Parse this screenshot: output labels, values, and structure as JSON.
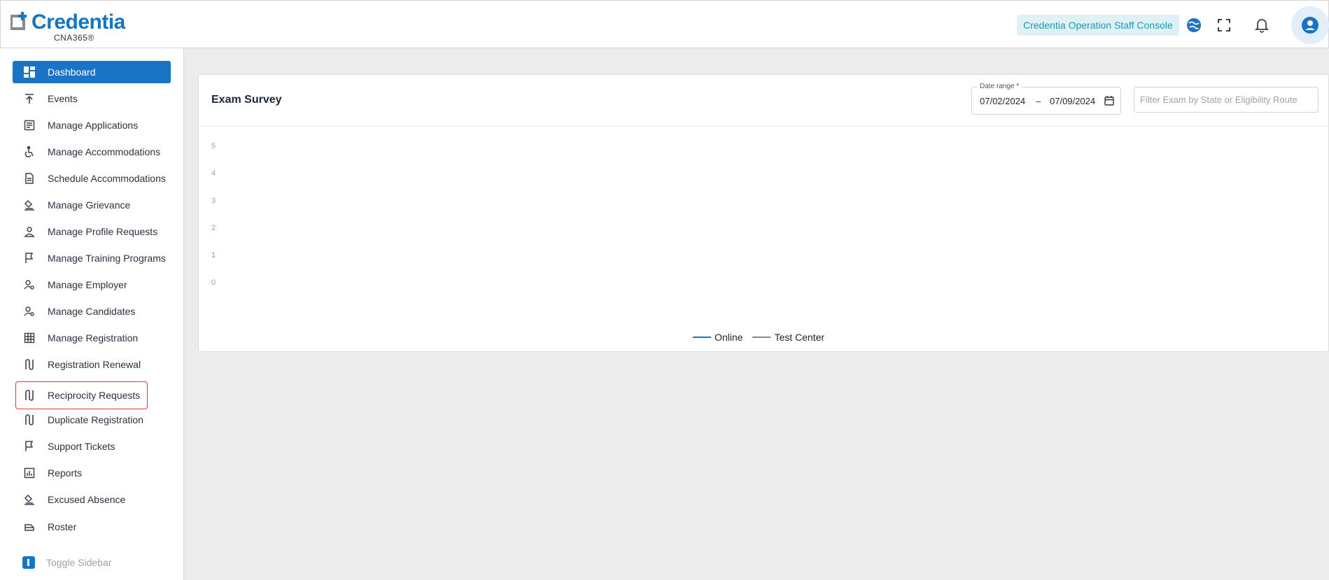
{
  "header": {
    "logo_text": "Credentia",
    "logo_sub": "CNA365®",
    "console_label": "Credentia Operation Staff Console"
  },
  "sidebar": {
    "items": [
      {
        "label": "Dashboard",
        "icon": "dashboard-icon",
        "active": true
      },
      {
        "label": "Events",
        "icon": "upload-icon"
      },
      {
        "label": "Manage Applications",
        "icon": "list-icon"
      },
      {
        "label": "Manage Accommodations",
        "icon": "accessibility-icon"
      },
      {
        "label": "Schedule Accommodations",
        "icon": "document-icon"
      },
      {
        "label": "Manage Grievance",
        "icon": "gavel-icon"
      },
      {
        "label": "Manage Profile Requests",
        "icon": "person-icon"
      },
      {
        "label": "Manage Training Programs",
        "icon": "flag-icon"
      },
      {
        "label": "Manage Employer",
        "icon": "user-gear-icon"
      },
      {
        "label": "Manage Candidates",
        "icon": "user-gear-icon"
      },
      {
        "label": "Manage Registration",
        "icon": "grid-icon"
      },
      {
        "label": "Registration Renewal",
        "icon": "route-icon"
      },
      {
        "label": "Reciprocity Requests",
        "icon": "route-icon",
        "highlight": true
      },
      {
        "label": "Duplicate Registration",
        "icon": "route-icon"
      },
      {
        "label": "Support Tickets",
        "icon": "flag-icon"
      },
      {
        "label": "Reports",
        "icon": "chart-icon"
      },
      {
        "label": "Excused Absence",
        "icon": "gavel-icon"
      },
      {
        "label": "Roster",
        "icon": "roster-icon"
      }
    ],
    "toggle_label": "Toggle Sidebar"
  },
  "card": {
    "title": "Exam Survey",
    "date_range": {
      "label": "Date range",
      "required_mark": "*",
      "start": "07/02/2024",
      "separator": "–",
      "end": "07/09/2024"
    },
    "filter": {
      "placeholder": "Filter Exam by State or Eligibility Route",
      "value": ""
    }
  },
  "chart_data": {
    "type": "line",
    "y_ticks": [
      "5",
      "4",
      "3",
      "2",
      "1",
      "0"
    ],
    "ylim": [
      0,
      5
    ],
    "series": [
      {
        "name": "Online",
        "color": "#1a74c6",
        "values": []
      },
      {
        "name": "Test Center",
        "color": "#888888",
        "values": []
      }
    ],
    "legend": "bottom-center"
  }
}
